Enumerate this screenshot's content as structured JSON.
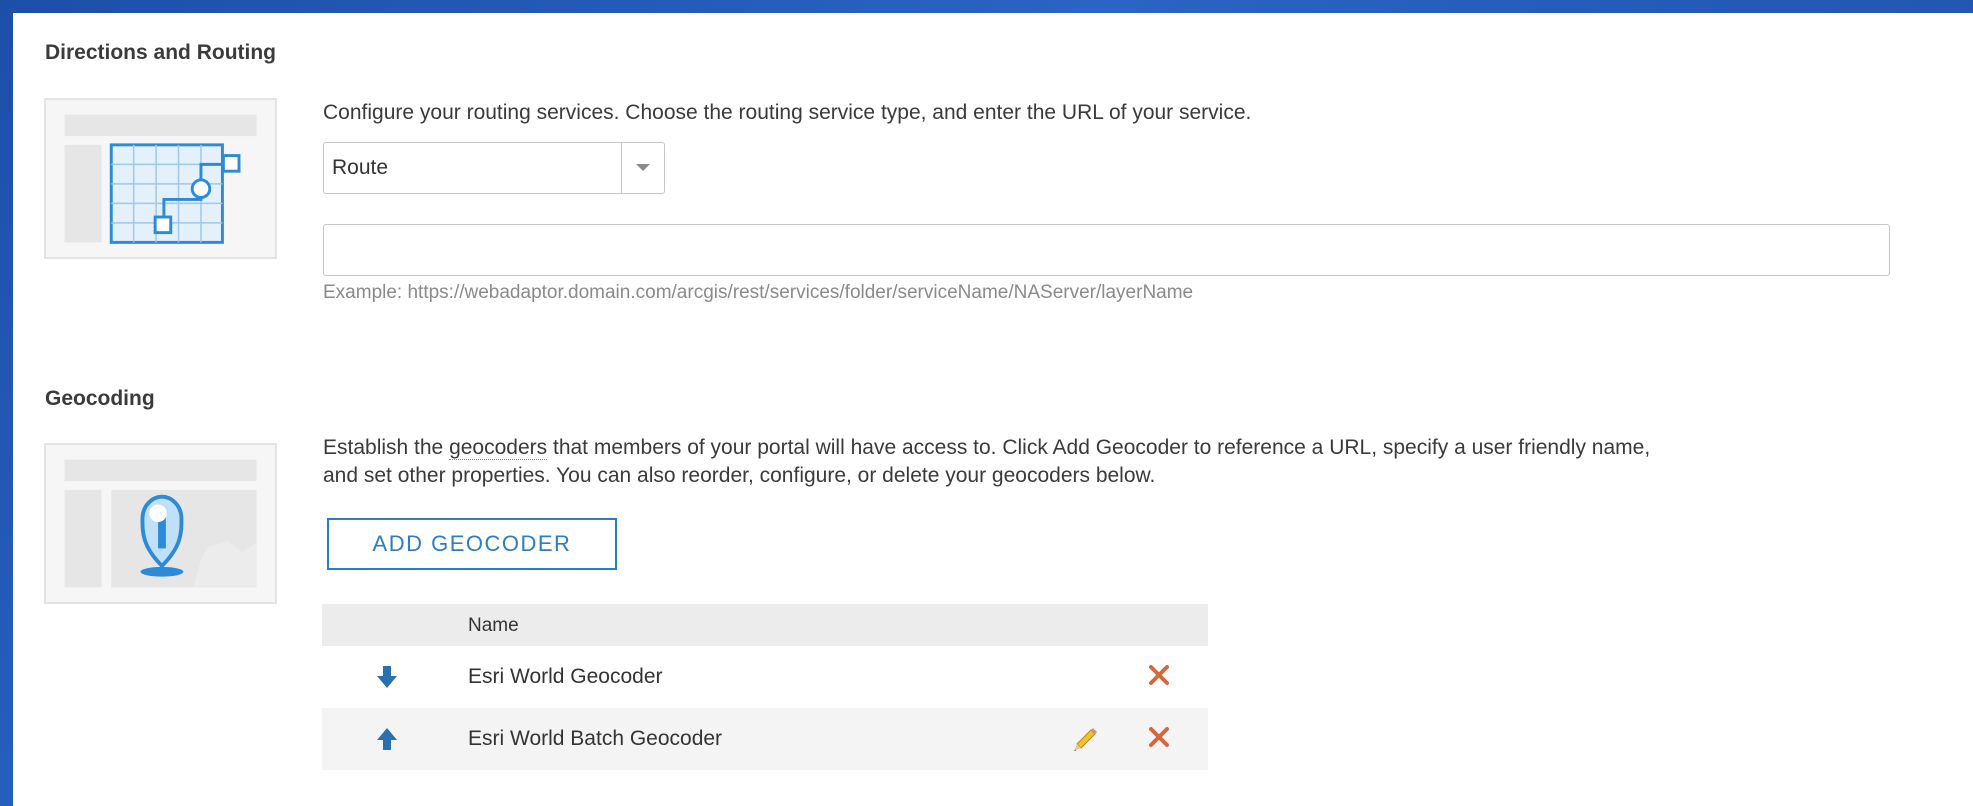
{
  "routing": {
    "title": "Directions and Routing",
    "description": "Configure your routing services. Choose the routing service type, and enter the URL of your service.",
    "service_type": "Route",
    "url_value": "",
    "example": "Example: https://webadaptor.domain.com/arcgis/rest/services/folder/serviceName/NAServer/layerName"
  },
  "geocoding": {
    "title": "Geocoding",
    "desc_before": "Establish the ",
    "desc_term": "geocoders",
    "desc_after": " that members of your portal will have access to. Click Add Geocoder to reference a URL, specify a user friendly name,",
    "desc_line2": "and set other properties. You can also reorder, configure, or delete your geocoders below.",
    "add_button": "ADD GEOCODER",
    "table_header": "Name",
    "rows": [
      {
        "name": "Esri World Geocoder",
        "arrow": "down",
        "editable": false
      },
      {
        "name": "Esri World Batch Geocoder",
        "arrow": "up",
        "editable": true
      }
    ]
  },
  "colors": {
    "accent": "#2d7dbf",
    "delete": "#d4683a",
    "background": "#1d4fa8"
  },
  "icons": [
    "routing-illustration",
    "geocoding-illustration",
    "arrow-down-icon",
    "arrow-up-icon",
    "pencil-icon",
    "delete-x-icon",
    "chevron-down-icon"
  ]
}
